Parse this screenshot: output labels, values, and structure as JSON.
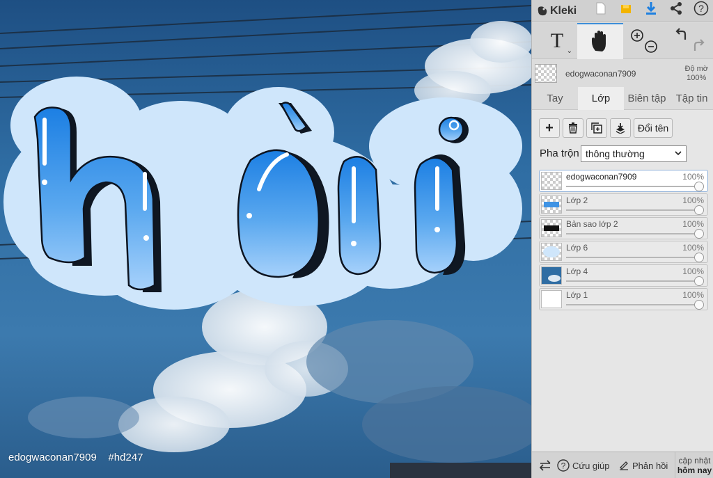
{
  "app": {
    "name": "Kleki"
  },
  "colors": {
    "accent": "#3d8ed9",
    "download": "#1d7fe0",
    "save": "#f2b400",
    "letter_blue": "#3f93e4"
  },
  "icons": {
    "new_image": "new-image-icon",
    "save": "save-icon",
    "download": "download-icon",
    "share": "share-icon",
    "help": "help-icon",
    "text_tool": "text-tool-icon",
    "hand_tool": "hand-tool-icon",
    "zoom_in": "zoom-in-icon",
    "zoom_out": "zoom-out-icon",
    "undo": "undo-icon",
    "redo": "redo-icon"
  },
  "tools": {
    "text_label": "T"
  },
  "current_layer": {
    "name": "edogwaconan7909",
    "opacity_label": "Độ mờ",
    "opacity_value": "100%"
  },
  "tabs": [
    {
      "label": "Tay",
      "active": false
    },
    {
      "label": "Lớp",
      "active": true
    },
    {
      "label": "Biên tập",
      "active": false
    },
    {
      "label": "Tập tin",
      "active": false
    }
  ],
  "layers_panel": {
    "rename_label": "Đổi tên",
    "blend_label": "Pha trộn",
    "blend_value": "thông thường"
  },
  "layers": [
    {
      "name": "edogwaconan7909",
      "opacity": "100%",
      "opacity_value": 1.0,
      "selected": true
    },
    {
      "name": "Lớp 2",
      "opacity": "100%",
      "opacity_value": 1.0,
      "selected": false
    },
    {
      "name": "Bản sao lớp 2",
      "opacity": "100%",
      "opacity_value": 1.0,
      "selected": false
    },
    {
      "name": "Lớp 6",
      "opacity": "100%",
      "opacity_value": 1.0,
      "selected": false
    },
    {
      "name": "Lớp 4",
      "opacity": "100%",
      "opacity_value": 1.0,
      "selected": false
    },
    {
      "name": "Lớp 1",
      "opacity": "100%",
      "opacity_value": 1.0,
      "selected": false
    }
  ],
  "bottom": {
    "help_label": "Cứu giúp",
    "feedback_label": "Phản hồi",
    "update_line1": "cập nhật",
    "update_line2": "hôm nay"
  },
  "canvas": {
    "artwork_text": "hời",
    "watermark": "edogwaconan7909    #hđ247"
  }
}
